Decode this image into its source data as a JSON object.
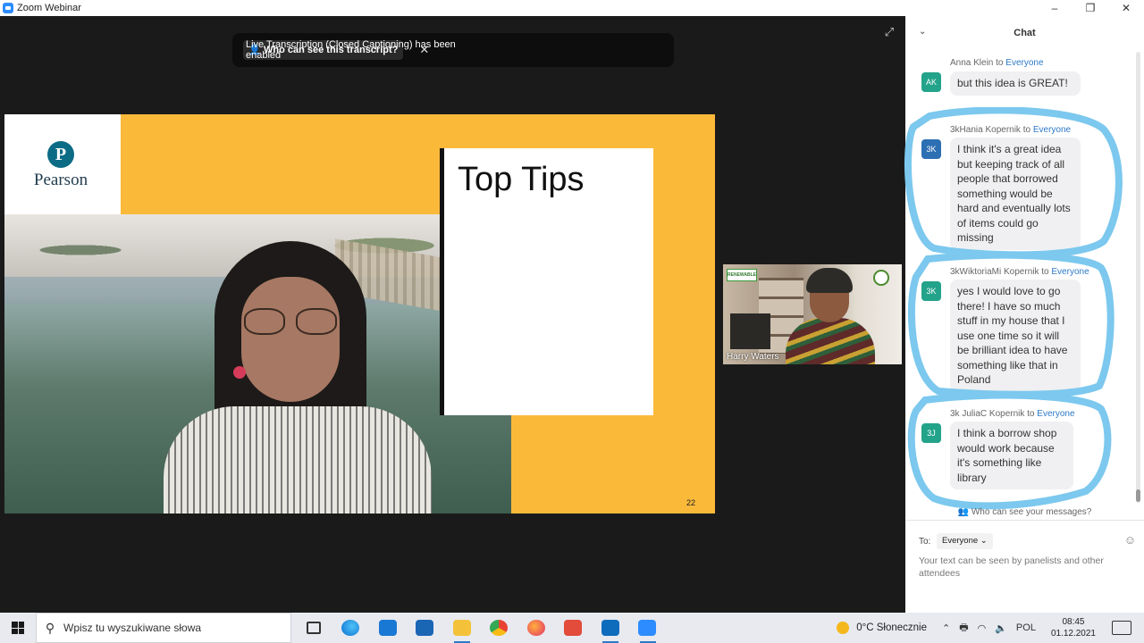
{
  "window": {
    "title": "Zoom Webinar",
    "controls": [
      "–",
      "❐",
      "✕"
    ]
  },
  "toast": {
    "message": "Live Transcription (Closed Captioning) has been enabled",
    "button": "Who can see this transcript?",
    "close": "✕"
  },
  "slide": {
    "logo_text": "Pearson",
    "logo_letter": "P",
    "title": "Top Tips",
    "page_number": "22"
  },
  "thumbnail": {
    "name": "Harry Waters",
    "badge": "RENEWABLE"
  },
  "chat": {
    "title": "Chat",
    "to_word": "to",
    "messages": [
      {
        "initials": "AK",
        "sender": "Anna Klein",
        "recipient": "Everyone",
        "text": "but  this idea is GREAT!",
        "color": "#23a38a"
      },
      {
        "initials": "3K",
        "sender": "3kHania Kopernik",
        "recipient": "Everyone",
        "text": "I think it's a great idea but keeping track of all people that borrowed something would be hard and eventually lots of items could go missing",
        "color": "#2d6fb3"
      },
      {
        "initials": "3K",
        "sender": "3kWiktoriaMi Kopernik",
        "recipient": "Everyone",
        "text": "yes I would love to go there! I have so much stuff in my house that I use one time so it will be brilliant idea to have something like that in Poland",
        "color": "#23a38a"
      },
      {
        "initials": "3J",
        "sender": "3k JuliaC Kopernik",
        "recipient": "Everyone",
        "text": "I think a borrow shop would work because it's something like library",
        "color": "#23a38a"
      }
    ],
    "who_can_see": "Who can see your messages?",
    "to_label": "To:",
    "to_value": "Everyone",
    "compose_hint": "Your text can be seen by panelists and other attendees",
    "annotation_color": "#7cc8ee"
  },
  "taskbar": {
    "search_placeholder": "Wpisz tu wyszukiwane słowa",
    "apps": [
      "task-view",
      "edge",
      "mail",
      "store",
      "explorer",
      "chrome",
      "firefox",
      "gift",
      "outlook",
      "zoom"
    ],
    "weather": "0°C  Słonecznie",
    "language": "POL",
    "time": "08:45",
    "date": "01.12.2021"
  }
}
